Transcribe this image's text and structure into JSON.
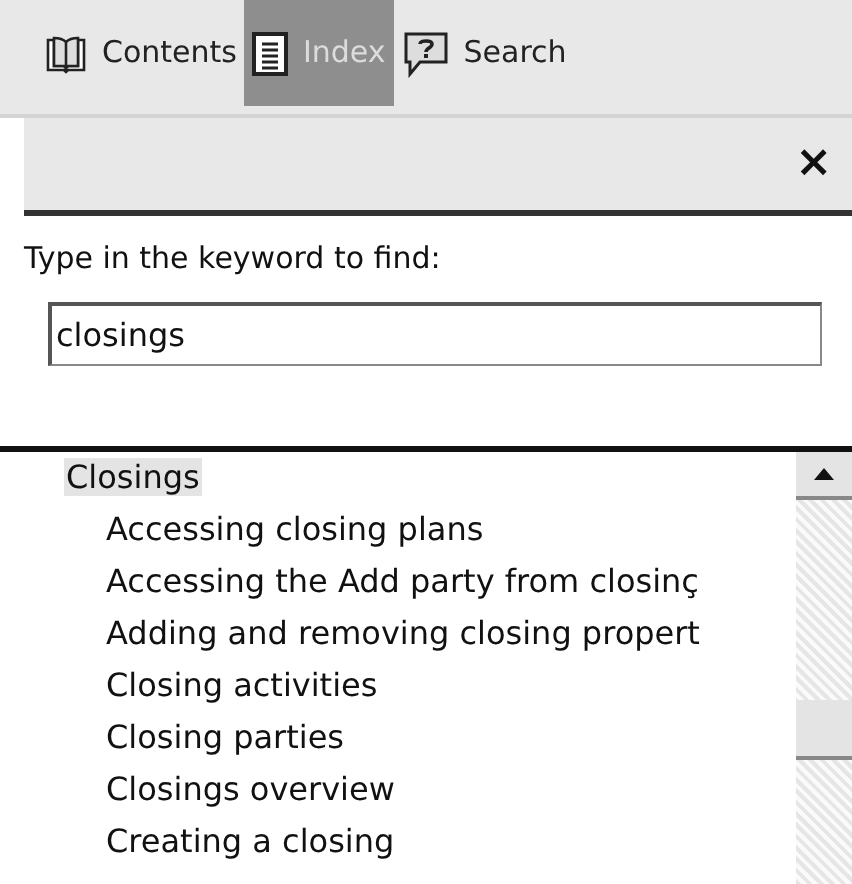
{
  "tabs": [
    {
      "label": "Contents",
      "kind": "book",
      "selected": false
    },
    {
      "label": "Index",
      "kind": "list",
      "selected": true
    },
    {
      "label": "Search",
      "kind": "question",
      "selected": false
    }
  ],
  "close_button": "×",
  "search": {
    "label": "Type in the keyword to find:",
    "value": "closings"
  },
  "index": [
    {
      "label": "Closings",
      "selected": true,
      "children": [
        {
          "label": "Accessing closing plans",
          "selected": false
        },
        {
          "label": "Accessing the Add party from closinç",
          "selected": false
        },
        {
          "label": "Adding and removing closing propert",
          "selected": false
        },
        {
          "label": "Closing activities",
          "selected": false
        },
        {
          "label": "Closing parties",
          "selected": false
        },
        {
          "label": "Closings overview",
          "selected": false
        },
        {
          "label": "Creating a closing",
          "selected": false
        }
      ]
    }
  ]
}
